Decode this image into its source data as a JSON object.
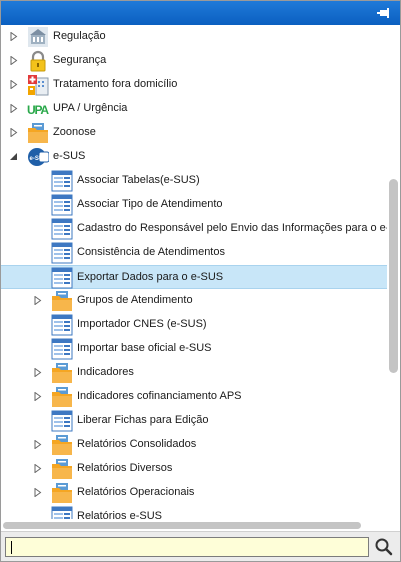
{
  "tree": {
    "items": [
      {
        "label": "Regulação",
        "icon": "building-icon",
        "level": 0,
        "expander": "collapsed"
      },
      {
        "label": "Segurança",
        "icon": "padlock-icon",
        "level": 0,
        "expander": "collapsed"
      },
      {
        "label": "Tratamento fora domicílio",
        "icon": "hospital-icon",
        "level": 0,
        "expander": "collapsed"
      },
      {
        "label": "UPA / Urgência",
        "icon": "upa-logo-icon",
        "icon_text": "UPA",
        "level": 0,
        "expander": "collapsed"
      },
      {
        "label": "Zoonose",
        "icon": "folder-icon",
        "level": 0,
        "expander": "collapsed"
      },
      {
        "label": "e-SUS",
        "icon": "esus-logo-icon",
        "icon_text": "e-SUS",
        "level": 0,
        "expander": "expanded"
      },
      {
        "label": "Associar Tabelas(e-SUS)",
        "icon": "form-icon",
        "level": 1,
        "expander": "none"
      },
      {
        "label": "Associar Tipo de Atendimento",
        "icon": "form-icon",
        "level": 1,
        "expander": "none"
      },
      {
        "label": "Cadastro do Responsável pelo Envio das Informações para o e-SUS",
        "icon": "form-icon",
        "level": 1,
        "expander": "none"
      },
      {
        "label": "Consistência de Atendimentos",
        "icon": "form-icon",
        "level": 1,
        "expander": "none"
      },
      {
        "label": "Exportar Dados para o e-SUS",
        "icon": "form-icon",
        "level": 1,
        "expander": "none",
        "selected": true
      },
      {
        "label": "Grupos de Atendimento",
        "icon": "folder-icon",
        "level": 1,
        "expander": "collapsed"
      },
      {
        "label": "Importador CNES (e-SUS)",
        "icon": "form-icon",
        "level": 1,
        "expander": "none"
      },
      {
        "label": "Importar base oficial e-SUS",
        "icon": "form-icon",
        "level": 1,
        "expander": "none"
      },
      {
        "label": "Indicadores",
        "icon": "folder-icon",
        "level": 1,
        "expander": "collapsed"
      },
      {
        "label": "Indicadores cofinanciamento APS",
        "icon": "folder-icon",
        "level": 1,
        "expander": "collapsed"
      },
      {
        "label": "Liberar Fichas para Edição",
        "icon": "form-icon",
        "level": 1,
        "expander": "none"
      },
      {
        "label": "Relatórios Consolidados",
        "icon": "folder-icon",
        "level": 1,
        "expander": "collapsed"
      },
      {
        "label": "Relatórios Diversos",
        "icon": "folder-icon",
        "level": 1,
        "expander": "collapsed"
      },
      {
        "label": "Relatórios Operacionais",
        "icon": "folder-icon",
        "level": 1,
        "expander": "collapsed"
      },
      {
        "label": "Relatórios e-SUS",
        "icon": "form-icon",
        "level": 1,
        "expander": "none"
      }
    ]
  },
  "header": {
    "pin_icon": "pin-icon"
  },
  "search": {
    "value": "",
    "button_icon": "search-icon"
  },
  "colors": {
    "titlebar": "#0b5fc0",
    "selected_row": "#c8e6f8",
    "search_field": "#fefed8",
    "folder": "#f5a623",
    "upa_green": "#2aa84a"
  }
}
